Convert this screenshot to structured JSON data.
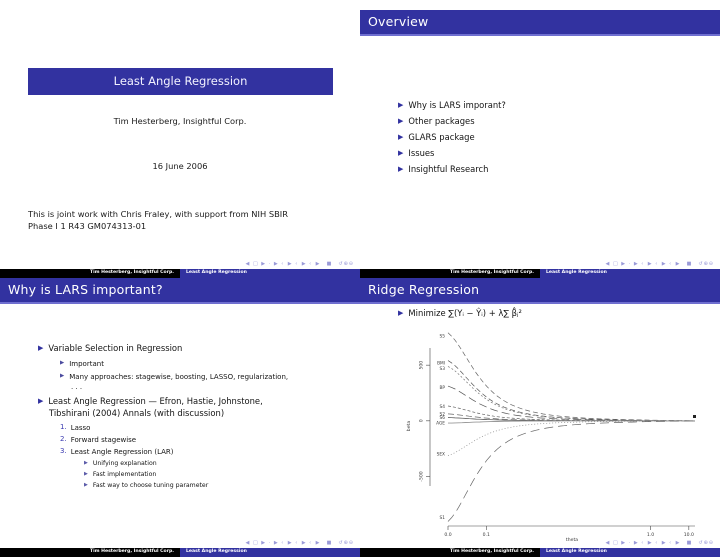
{
  "deck": {
    "author": "Tim Hesterberg, Insightful Corp.",
    "short_title": "Least Angle Regression",
    "nav_symbols": "◀ □ ▶ · ▶ ‹ ▶ ‹ ▶ ‹ ▶  ■  ↺⊕⊖"
  },
  "slide1": {
    "title": "Least Angle Regression",
    "author": "Tim Hesterberg, Insightful Corp.",
    "date": "16 June 2006",
    "note_line1": "This is joint work with Chris Fraley, with support from NIH SBIR",
    "note_line2": "Phase I 1 R43 GM074313-01"
  },
  "slide2": {
    "title": "Overview",
    "items": [
      "Why is LARS imporant?",
      "Other packages",
      "GLARS package",
      "Issues",
      "Insightful Research"
    ]
  },
  "slide3": {
    "title": "Why is LARS important?",
    "item1": "Variable Selection in Regression",
    "item1_sub1": "Important",
    "item1_sub2": "Many approaches: stagewise, boosting, LASSO, regularization,",
    "item1_sub3": ". . .",
    "item2_line1": "Least Angle Regression — Efron, Hastie, Johnstone,",
    "item2_line2": "Tibshirani (2004) Annals (with discussion)",
    "enum": [
      {
        "n": "1.",
        "label": "Lasso"
      },
      {
        "n": "2.",
        "label": "Forward stagewise"
      },
      {
        "n": "3.",
        "label": "Least Angle Regression (LAR)"
      }
    ],
    "enum3_subs": [
      "Unifying explanation",
      "Fast implementation",
      "Fast way to choose tuning parameter"
    ]
  },
  "slide4": {
    "title": "Ridge Regression",
    "formula_prefix": "Minimize",
    "formula_text": "∑(Yᵢ − Ŷᵢ) + λ∑ β̂ⱼ²"
  },
  "chart_data": {
    "type": "line",
    "title": "",
    "xlabel": "theta",
    "ylabel": "beta",
    "xticks": [
      "0.0",
      "0.1",
      "1.0",
      "10.0"
    ],
    "xtick_pos": [
      0.0,
      0.155,
      0.82,
      0.975
    ],
    "yticks": [
      "500",
      "0",
      "-500"
    ],
    "ytick_pos": [
      500,
      0,
      -500
    ],
    "ylim": [
      -900,
      780
    ],
    "grid": false,
    "legend": "none",
    "right_labels_note": "series labelled at left axis",
    "series": [
      {
        "name": "S5",
        "label_y": 760,
        "start": 760,
        "dash": "5,3",
        "color": "#666666",
        "width": 0.7
      },
      {
        "name": "BMI",
        "label_y": 520,
        "start": 520,
        "dash": "5,3",
        "color": "#555555",
        "width": 0.7
      },
      {
        "name": "S3",
        "label_y": 470,
        "start": 470,
        "dash": "2,2",
        "color": "#777777",
        "width": 0.7
      },
      {
        "name": "BP",
        "label_y": 300,
        "start": 300,
        "dash": "8,4",
        "color": "#555555",
        "width": 0.7
      },
      {
        "name": "S4",
        "label_y": 128,
        "start": 128,
        "dash": "3,2",
        "color": "#666666",
        "width": 0.7
      },
      {
        "name": "S2",
        "label_y": 60,
        "start": 60,
        "dash": "6,3",
        "color": "#666666",
        "width": 0.7
      },
      {
        "name": "S6",
        "label_y": 28,
        "start": 28,
        "dash": "none",
        "color": "#444444",
        "width": 0.7
      },
      {
        "name": "AGE",
        "label_y": -20,
        "start": -20,
        "dash": "none",
        "color": "#999999",
        "width": 0.9
      },
      {
        "name": "SEX",
        "label_y": -300,
        "start": -300,
        "dash": "1,2",
        "color": "#888888",
        "width": 0.7
      },
      {
        "name": "S1",
        "label_y": -870,
        "start": -870,
        "dash": "9,5",
        "color": "#666666",
        "width": 0.7
      }
    ]
  }
}
